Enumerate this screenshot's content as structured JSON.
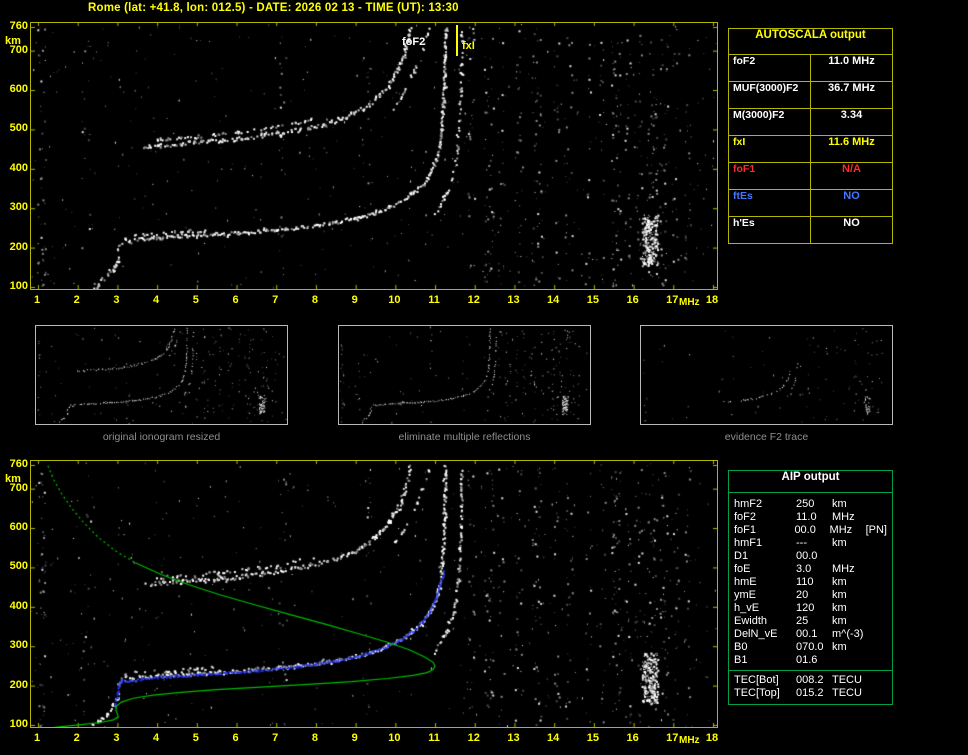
{
  "title": "Rome (lat: +41.8, lon: 012.5) - DATE: 2026 02 13 - TIME (UT): 13:30",
  "captions": [
    "original ionogram resized",
    "eliminate multiple reflections",
    "evidence F2 trace"
  ],
  "colors": {
    "background": "#000000",
    "axis": "#b5b500",
    "tick_text": "#ffff00",
    "trace_white": "#ffffff",
    "green": "#00bb00",
    "blue": "#2f3eff",
    "red": "#ff2a2a",
    "es_blue": "#4477ff",
    "caption_gray": "#8f8f8f",
    "aip_border": "#00a048"
  },
  "autoscala": {
    "header": "AUTOSCALA output",
    "rows": [
      {
        "label": "foF2",
        "value": "11.0 MHz",
        "color": "#ffffff"
      },
      {
        "label": "MUF(3000)F2",
        "value": "36.7 MHz",
        "color": "#ffffff"
      },
      {
        "label": "M(3000)F2",
        "value": "3.34",
        "color": "#ffffff"
      },
      {
        "label": "fxI",
        "value": "11.6 MHz",
        "color": "#ffff00"
      },
      {
        "label": "foF1",
        "value": "N/A",
        "color": "#ff2a2a"
      },
      {
        "label": "ftEs",
        "value": "NO",
        "color": "#4477ff"
      },
      {
        "label": "h'Es",
        "value": "NO",
        "color": "#ffffff"
      }
    ]
  },
  "aip": {
    "header": "AIP output",
    "rows": [
      {
        "label": "hmF2",
        "value": "250",
        "unit": "km",
        "note": ""
      },
      {
        "label": "foF2",
        "value": "11.0",
        "unit": "MHz",
        "note": ""
      },
      {
        "label": "foF1",
        "value": "00.0",
        "unit": "MHz",
        "note": "[PN]"
      },
      {
        "label": "hmF1",
        "value": "---",
        "unit": "km",
        "note": ""
      },
      {
        "label": "D1",
        "value": "00.0",
        "unit": "",
        "note": ""
      },
      {
        "label": "foE",
        "value": "3.0",
        "unit": "MHz",
        "note": ""
      },
      {
        "label": "hmE",
        "value": "110",
        "unit": "km",
        "note": ""
      },
      {
        "label": "ymE",
        "value": "20",
        "unit": "km",
        "note": ""
      },
      {
        "label": "h_vE",
        "value": "120",
        "unit": "km",
        "note": ""
      },
      {
        "label": "Ewidth",
        "value": "25",
        "unit": "km",
        "note": ""
      },
      {
        "label": "DelN_vE",
        "value": "00.1",
        "unit": "m^(-3)",
        "note": ""
      },
      {
        "label": "B0",
        "value": "070.0",
        "unit": "km",
        "note": ""
      },
      {
        "label": "B1",
        "value": "01.6",
        "unit": "",
        "note": ""
      }
    ],
    "tec_rows": [
      {
        "label": "TEC[Bot]",
        "value": "008.2",
        "unit": "TECU"
      },
      {
        "label": "TEC[Top]",
        "value": "015.2",
        "unit": "TECU"
      }
    ]
  },
  "chart_data": {
    "type": "scatter",
    "title": "Ionogram with AUTOSCALA automatic scaling",
    "x_axis": {
      "label": "MHz",
      "range": [
        1,
        18
      ],
      "ticks": [
        1,
        2,
        3,
        4,
        5,
        6,
        7,
        8,
        9,
        10,
        11,
        12,
        13,
        14,
        15,
        16,
        17,
        18
      ]
    },
    "y_axis": {
      "label": "km",
      "range": [
        100,
        760
      ],
      "ticks": [
        760,
        700,
        600,
        500,
        400,
        300,
        200,
        100
      ]
    },
    "annotations": {
      "foF2": "foF2",
      "fxI": "fxI",
      "fxI_marker_mhz": 11.6,
      "foF2_mhz": 11.0
    },
    "traces": {
      "e_trace": [
        [
          2.4,
          102
        ],
        [
          2.5,
          110
        ],
        [
          2.62,
          120
        ],
        [
          2.75,
          132
        ],
        [
          2.87,
          147
        ],
        [
          2.97,
          163
        ],
        [
          3.02,
          176
        ]
      ],
      "step": [
        [
          2.98,
          196
        ],
        [
          3.08,
          212
        ],
        [
          3.18,
          226
        ],
        [
          3.32,
          216
        ],
        [
          3.45,
          222
        ],
        [
          3.55,
          226
        ]
      ],
      "f1_o": [
        [
          3.55,
          224
        ],
        [
          4.0,
          227
        ],
        [
          4.5,
          230
        ],
        [
          5.0,
          233
        ],
        [
          5.5,
          236
        ],
        [
          6.0,
          239
        ],
        [
          6.5,
          243
        ],
        [
          7.0,
          247
        ],
        [
          7.5,
          252
        ],
        [
          8.0,
          258
        ],
        [
          8.5,
          266
        ],
        [
          9.0,
          276
        ],
        [
          9.4,
          287
        ],
        [
          9.8,
          302
        ],
        [
          10.1,
          317
        ],
        [
          10.4,
          337
        ],
        [
          10.65,
          360
        ],
        [
          10.85,
          388
        ],
        [
          11.0,
          420
        ],
        [
          11.1,
          458
        ],
        [
          11.15,
          505
        ],
        [
          11.19,
          560
        ],
        [
          11.22,
          630
        ],
        [
          11.24,
          760
        ]
      ],
      "f1_b": [
        [
          3.4,
          234
        ],
        [
          3.9,
          238
        ],
        [
          4.4,
          241
        ],
        [
          4.9,
          244
        ],
        [
          5.4,
          247
        ]
      ],
      "f1_x": [
        [
          10.95,
          285
        ],
        [
          11.12,
          310
        ],
        [
          11.27,
          340
        ],
        [
          11.4,
          375
        ],
        [
          11.5,
          415
        ],
        [
          11.56,
          465
        ],
        [
          11.6,
          525
        ],
        [
          11.63,
          600
        ],
        [
          11.65,
          700
        ],
        [
          11.66,
          760
        ]
      ],
      "hop2_o": [
        [
          3.65,
          458
        ],
        [
          4.1,
          462
        ],
        [
          4.6,
          466
        ],
        [
          5.1,
          470
        ],
        [
          5.6,
          474
        ],
        [
          6.1,
          479
        ],
        [
          6.6,
          485
        ],
        [
          7.1,
          492
        ],
        [
          7.6,
          501
        ],
        [
          8.1,
          512
        ],
        [
          8.6,
          527
        ],
        [
          9.0,
          545
        ],
        [
          9.3,
          563
        ],
        [
          9.6,
          588
        ],
        [
          9.85,
          618
        ],
        [
          10.05,
          652
        ],
        [
          10.2,
          692
        ],
        [
          10.3,
          732
        ],
        [
          10.36,
          760
        ]
      ],
      "hop2_b": [
        [
          4.0,
          476
        ],
        [
          4.5,
          480
        ],
        [
          5.0,
          484
        ],
        [
          5.5,
          489
        ],
        [
          6.0,
          494
        ],
        [
          6.5,
          500
        ],
        [
          7.0,
          508
        ],
        [
          7.5,
          518
        ],
        [
          8.0,
          530
        ]
      ],
      "hop2_x": [
        [
          9.95,
          556
        ],
        [
          10.2,
          598
        ],
        [
          10.45,
          648
        ],
        [
          10.65,
          700
        ],
        [
          10.8,
          745
        ],
        [
          10.85,
          760
        ]
      ],
      "f2_flat": [
        [
          6.5,
          243
        ],
        [
          7.0,
          247
        ],
        [
          7.5,
          252
        ],
        [
          8.0,
          258
        ],
        [
          8.5,
          266
        ],
        [
          9.0,
          276
        ],
        [
          9.4,
          287
        ],
        [
          9.8,
          302
        ],
        [
          10.1,
          317
        ],
        [
          10.4,
          337
        ],
        [
          10.65,
          360
        ],
        [
          10.85,
          388
        ],
        [
          11.0,
          420
        ],
        [
          11.1,
          458
        ]
      ],
      "f2_x_ev": [
        [
          10.95,
          285
        ],
        [
          11.15,
          315
        ],
        [
          11.3,
          350
        ],
        [
          11.45,
          395
        ],
        [
          11.55,
          450
        ],
        [
          11.6,
          510
        ]
      ]
    },
    "profile_green": {
      "dotted": [
        [
          1.25,
          758
        ],
        [
          1.4,
          722
        ],
        [
          1.6,
          686
        ],
        [
          1.85,
          650
        ],
        [
          2.15,
          614
        ],
        [
          2.5,
          578
        ],
        [
          2.95,
          542
        ],
        [
          3.45,
          512
        ]
      ],
      "solid": [
        [
          3.45,
          512
        ],
        [
          4.1,
          482
        ],
        [
          4.8,
          456
        ],
        [
          5.6,
          430
        ],
        [
          6.5,
          404
        ],
        [
          7.4,
          379
        ],
        [
          8.3,
          354
        ],
        [
          9.1,
          331
        ],
        [
          9.8,
          310
        ],
        [
          10.35,
          291
        ],
        [
          10.75,
          272
        ],
        [
          10.95,
          259
        ],
        [
          11.0,
          250
        ],
        [
          10.95,
          241
        ],
        [
          10.8,
          233
        ],
        [
          10.45,
          226
        ],
        [
          9.8,
          218
        ],
        [
          8.9,
          210
        ],
        [
          7.8,
          203
        ],
        [
          6.6,
          196
        ],
        [
          5.5,
          190
        ],
        [
          4.6,
          183
        ],
        [
          3.9,
          176
        ],
        [
          3.4,
          168
        ],
        [
          3.1,
          158
        ],
        [
          2.98,
          148
        ],
        [
          2.96,
          138
        ],
        [
          3.0,
          128
        ],
        [
          3.02,
          120
        ],
        [
          2.9,
          113
        ],
        [
          2.6,
          107
        ],
        [
          2.1,
          101
        ],
        [
          1.6,
          96
        ],
        [
          1.25,
          92
        ]
      ]
    },
    "blue_trace": [
      [
        2.92,
        152
      ],
      [
        2.98,
        178
      ],
      [
        3.02,
        205
      ],
      [
        3.1,
        215
      ],
      [
        3.3,
        213
      ],
      [
        3.6,
        218
      ],
      [
        4.0,
        222
      ],
      [
        4.5,
        226
      ],
      [
        5.0,
        229
      ],
      [
        5.5,
        232
      ],
      [
        6.0,
        236
      ],
      [
        6.5,
        240
      ],
      [
        7.0,
        245
      ],
      [
        7.5,
        250
      ],
      [
        8.0,
        257
      ],
      [
        8.5,
        265
      ],
      [
        9.0,
        275
      ],
      [
        9.4,
        287
      ],
      [
        9.8,
        302
      ],
      [
        10.1,
        317
      ],
      [
        10.4,
        338
      ],
      [
        10.65,
        362
      ],
      [
        10.85,
        390
      ],
      [
        11.0,
        422
      ],
      [
        11.1,
        455
      ],
      [
        11.2,
        490
      ]
    ],
    "noise_bands": [
      {
        "mhz": 1.08,
        "count": 45,
        "spread": 0.1
      },
      {
        "mhz": 2.2,
        "count": 12,
        "spread": 0.12
      },
      {
        "mhz": 7.15,
        "count": 22,
        "spread": 0.1
      },
      {
        "mhz": 9.3,
        "count": 14,
        "spread": 0.08
      },
      {
        "mhz": 11.9,
        "count": 26,
        "spread": 0.1
      },
      {
        "mhz": 12.35,
        "count": 42,
        "spread": 0.12
      },
      {
        "mhz": 12.65,
        "count": 20,
        "spread": 0.08
      },
      {
        "mhz": 13.1,
        "count": 28,
        "spread": 0.1
      },
      {
        "mhz": 13.55,
        "count": 46,
        "spread": 0.12
      },
      {
        "mhz": 14.05,
        "count": 16,
        "spread": 0.08
      },
      {
        "mhz": 14.35,
        "count": 24,
        "spread": 0.1
      },
      {
        "mhz": 14.85,
        "count": 18,
        "spread": 0.08
      },
      {
        "mhz": 15.2,
        "count": 16,
        "spread": 0.08
      },
      {
        "mhz": 15.55,
        "count": 60,
        "spread": 0.12
      },
      {
        "mhz": 15.85,
        "count": 22,
        "spread": 0.08
      },
      {
        "mhz": 16.1,
        "count": 28,
        "spread": 0.1
      },
      {
        "mhz": 16.45,
        "count": 50,
        "spread": 0.12
      },
      {
        "mhz": 16.75,
        "count": 38,
        "spread": 0.1
      },
      {
        "mhz": 17.05,
        "count": 18,
        "spread": 0.08
      },
      {
        "mhz": 17.35,
        "count": 20,
        "spread": 0.08
      },
      {
        "mhz": 16.4,
        "count": 240,
        "spread": 0.2,
        "km_min": 155,
        "km_max": 285,
        "bright": true
      }
    ],
    "panels": {
      "top": {
        "seed": 7,
        "speckle": 420,
        "bandScale": 1,
        "ticks": true,
        "green": false,
        "blue": false,
        "traces": [
          [
            "e_trace",
            0.8,
            2,
            3,
            5
          ],
          [
            "step",
            0.75,
            2,
            3,
            4
          ],
          [
            "f1_o",
            0.95,
            2,
            2.5,
            3
          ],
          [
            "f1_b",
            0.4,
            2,
            2.5,
            3
          ],
          [
            "f1_x",
            0.55,
            2,
            2,
            3
          ],
          [
            "hop2_o",
            0.9,
            2,
            3,
            4
          ],
          [
            "hop2_b",
            0.45,
            2,
            2.5,
            3
          ],
          [
            "hop2_x",
            0.4,
            2,
            2,
            3
          ]
        ]
      },
      "bottom": {
        "seed": 13,
        "speckle": 420,
        "bandScale": 1,
        "ticks": true,
        "green": true,
        "blue": true,
        "traces": [
          [
            "e_trace",
            0.8,
            2,
            3,
            5
          ],
          [
            "step",
            0.75,
            2,
            3,
            4
          ],
          [
            "f1_o",
            0.95,
            2,
            2.5,
            3
          ],
          [
            "f1_b",
            0.4,
            2,
            2.5,
            3
          ],
          [
            "f1_x",
            0.55,
            2,
            2,
            3
          ],
          [
            "hop2_o",
            0.9,
            2,
            3,
            4
          ],
          [
            "hop2_b",
            0.45,
            2,
            2.5,
            3
          ],
          [
            "hop2_x",
            0.4,
            2,
            2,
            3
          ]
        ]
      },
      "thumb1": {
        "seed": 3,
        "speckle": 80,
        "bandScale": 0.25,
        "small": true,
        "traces": [
          [
            "e_trace",
            0.7,
            1,
            1.5,
            2
          ],
          [
            "step",
            0.6,
            1,
            1.5,
            2
          ],
          [
            "f1_o",
            0.8,
            1,
            1.2,
            1.5
          ],
          [
            "f1_x",
            0.4,
            1,
            1,
            1.5
          ],
          [
            "hop2_o",
            0.75,
            1,
            1.5,
            2
          ],
          [
            "hop2_x",
            0.3,
            1,
            1,
            1.5
          ]
        ]
      },
      "thumb2": {
        "seed": 5,
        "speckle": 70,
        "bandScale": 0.3,
        "small": true,
        "traces": [
          [
            "e_trace",
            0.7,
            1,
            1.5,
            2
          ],
          [
            "step",
            0.6,
            1,
            1.5,
            2
          ],
          [
            "f1_o",
            0.8,
            1,
            1.2,
            1.5
          ],
          [
            "f1_x",
            0.4,
            1,
            1,
            1.5
          ]
        ]
      },
      "thumb3": {
        "seed": 9,
        "speckle": 40,
        "bandScale": 0.12,
        "small": true,
        "traces": [
          [
            "f2_flat",
            0.6,
            1,
            1.2,
            1.5
          ],
          [
            "f2_x_ev",
            0.35,
            1,
            1,
            1.5
          ]
        ]
      }
    }
  }
}
